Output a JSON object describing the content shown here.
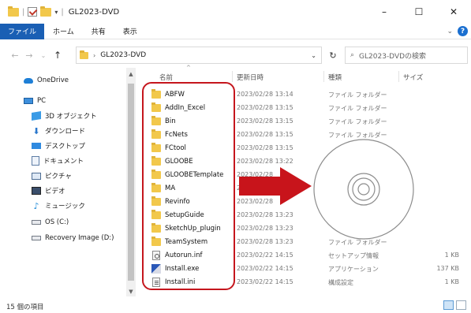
{
  "window": {
    "title": "GL2023-DVD",
    "minimize": "–",
    "maximize": "☐",
    "close": "✕"
  },
  "ribbon": {
    "tabs": [
      "ファイル",
      "ホーム",
      "共有",
      "表示"
    ],
    "help": "?"
  },
  "address": {
    "path": "GL2023-DVD",
    "search_placeholder": "GL2023-DVDの検索"
  },
  "sidebar": {
    "items": [
      "OneDrive",
      "PC",
      "3D オブジェクト",
      "ダウンロード",
      "デスクトップ",
      "ドキュメント",
      "ピクチャ",
      "ビデオ",
      "ミュージック",
      "OS (C:)",
      "Recovery Image (D:)"
    ]
  },
  "columns": {
    "name": "名前",
    "date": "更新日時",
    "type": "種類",
    "size": "サイズ"
  },
  "files": [
    {
      "name": "ABFW",
      "date": "2023/02/28 13:14",
      "type": "ファイル フォルダー",
      "size": "",
      "icon": "folder"
    },
    {
      "name": "AddIn_Excel",
      "date": "2023/02/28 13:15",
      "type": "ファイル フォルダー",
      "size": "",
      "icon": "folder"
    },
    {
      "name": "Bin",
      "date": "2023/02/28 13:15",
      "type": "ファイル フォルダー",
      "size": "",
      "icon": "folder"
    },
    {
      "name": "FcNets",
      "date": "2023/02/28 13:15",
      "type": "ファイル フォルダー",
      "size": "",
      "icon": "folder"
    },
    {
      "name": "FCtool",
      "date": "2023/02/28 13:15",
      "type": "",
      "size": "",
      "icon": "folder"
    },
    {
      "name": "GLOOBE",
      "date": "2023/02/28 13:22",
      "type": "",
      "size": "",
      "icon": "folder"
    },
    {
      "name": "GLOOBETemplate",
      "date": "2023/02/28",
      "type": "",
      "size": "",
      "icon": "folder"
    },
    {
      "name": "MA",
      "date": "20",
      "type": "",
      "size": "",
      "icon": "folder"
    },
    {
      "name": "Revinfo",
      "date": "2023/02/28",
      "type": "",
      "size": "",
      "icon": "folder"
    },
    {
      "name": "SetupGuide",
      "date": "2023/02/28 13:23",
      "type": "",
      "size": "",
      "icon": "folder"
    },
    {
      "name": "SketchUp_plugin",
      "date": "2023/02/28 13:23",
      "type": "",
      "size": "",
      "icon": "folder"
    },
    {
      "name": "TeamSystem",
      "date": "2023/02/28 13:23",
      "type": "ファイル フォルダー",
      "size": "",
      "icon": "folder"
    },
    {
      "name": "Autorun.inf",
      "date": "2023/02/22 14:15",
      "type": "セットアップ情報",
      "size": "1 KB",
      "icon": "inf"
    },
    {
      "name": "Install.exe",
      "date": "2023/02/22 14:15",
      "type": "アプリケーション",
      "size": "137 KB",
      "icon": "exe"
    },
    {
      "name": "Install.ini",
      "date": "2023/02/22 14:15",
      "type": "構成設定",
      "size": "1 KB",
      "icon": "ini"
    }
  ],
  "status": {
    "count": "15 個の項目"
  },
  "colors": {
    "accent": "#1a5fb4",
    "highlight": "#c5161d",
    "folder": "#f2c84b"
  }
}
